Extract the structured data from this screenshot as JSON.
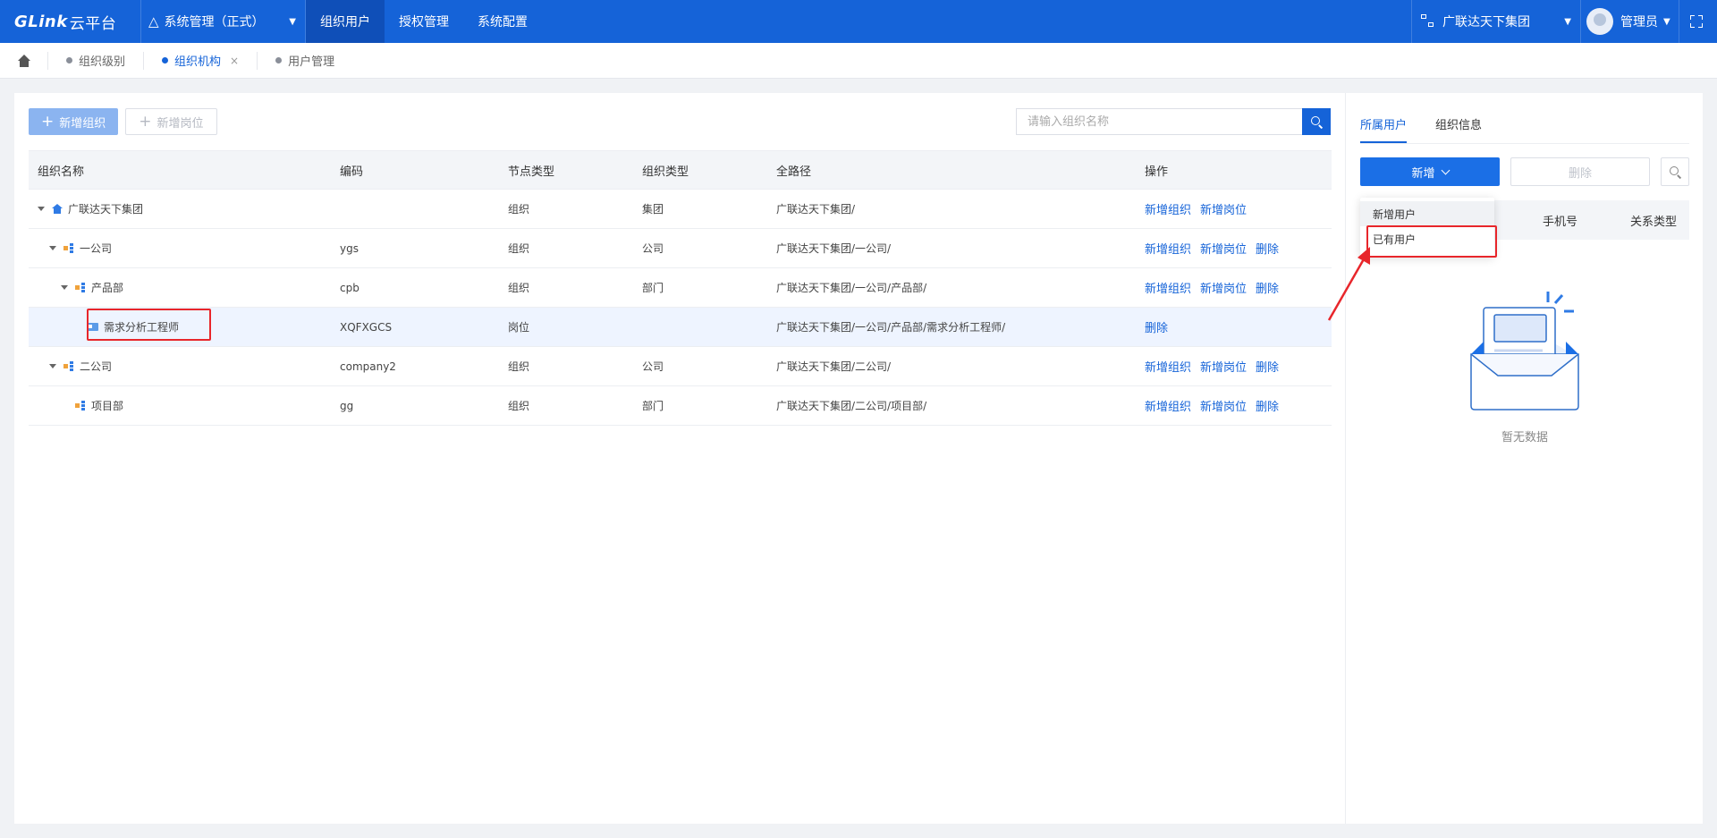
{
  "topnav": {
    "logo": "GLink",
    "logo_suffix": "云平台",
    "system_select": "系统管理（正式）",
    "menu": [
      {
        "label": "组织用户",
        "active": true
      },
      {
        "label": "授权管理",
        "active": false
      },
      {
        "label": "系统配置",
        "active": false
      }
    ],
    "org_switch": "广联达天下集团",
    "user_name": "管理员"
  },
  "tabs": [
    {
      "label": "组织级别",
      "active": false
    },
    {
      "label": "组织机构",
      "active": true,
      "close": "×"
    },
    {
      "label": "用户管理",
      "active": false
    }
  ],
  "toolbar": {
    "add_org": "新增组织",
    "add_post": "新增岗位",
    "search_placeholder": "请输入组织名称"
  },
  "table": {
    "columns": [
      "组织名称",
      "编码",
      "节点类型",
      "组织类型",
      "全路径",
      "操作"
    ],
    "rows": [
      {
        "name": "广联达天下集团",
        "code": "",
        "node_type": "组织",
        "org_type": "集团",
        "path": "广联达天下集团/",
        "ops": [
          "新增组织",
          "新增岗位"
        ],
        "icon": "home-icon",
        "level": 0,
        "expanded": true
      },
      {
        "name": "一公司",
        "code": "ygs",
        "node_type": "组织",
        "org_type": "公司",
        "path": "广联达天下集团/一公司/",
        "ops": [
          "新增组织",
          "新增岗位",
          "删除"
        ],
        "icon": "tree-icon",
        "level": 1,
        "expanded": true
      },
      {
        "name": "产品部",
        "code": "cpb",
        "node_type": "组织",
        "org_type": "部门",
        "path": "广联达天下集团/一公司/产品部/",
        "ops": [
          "新增组织",
          "新增岗位",
          "删除"
        ],
        "icon": "tree-icon",
        "level": 2,
        "expanded": true
      },
      {
        "name": "需求分析工程师",
        "code": "XQFXGCS",
        "node_type": "岗位",
        "org_type": "",
        "path": "广联达天下集团/一公司/产品部/需求分析工程师/",
        "ops": [
          "删除"
        ],
        "icon": "card-icon",
        "level": 3,
        "expanded": false
      },
      {
        "name": "二公司",
        "code": "company2",
        "node_type": "组织",
        "org_type": "公司",
        "path": "广联达天下集团/二公司/",
        "ops": [
          "新增组织",
          "新增岗位",
          "删除"
        ],
        "icon": "tree-icon",
        "level": 1,
        "expanded": true
      },
      {
        "name": "项目部",
        "code": "gg",
        "node_type": "组织",
        "org_type": "部门",
        "path": "广联达天下集团/二公司/项目部/",
        "ops": [
          "新增组织",
          "新增岗位",
          "删除"
        ],
        "icon": "tree-icon",
        "level": 2,
        "expanded": false
      }
    ]
  },
  "right_panel": {
    "tabs": [
      {
        "label": "所属用户",
        "active": true
      },
      {
        "label": "组织信息",
        "active": false
      }
    ],
    "add_button": "新增",
    "delete_button": "删除",
    "columns_visible": [
      "手机号",
      "关系类型"
    ],
    "empty_text": "暂无数据",
    "dropdown": [
      "新增用户",
      "已有用户"
    ]
  },
  "colors": {
    "primary": "#1563d8",
    "highlight_box": "#e8262b"
  }
}
